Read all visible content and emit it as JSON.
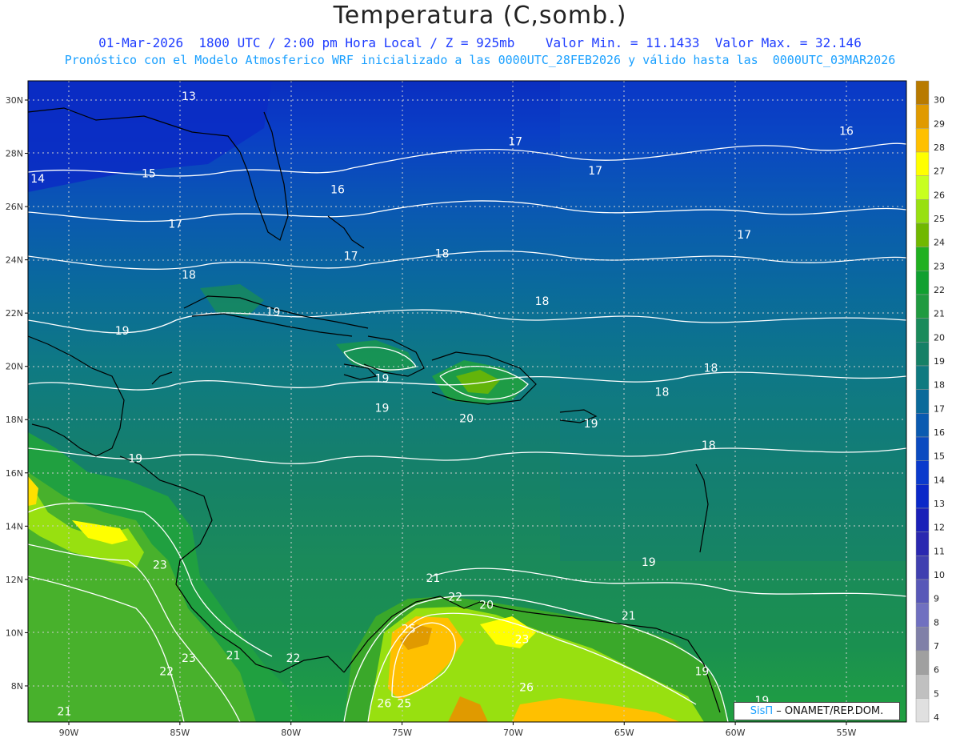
{
  "header": {
    "title": "Temperatura (C,somb.)",
    "line1": "01-Mar-2026  1800 UTC / 2:00 pm Hora Local / Z = 925mb    Valor Min. = 11.1433  Valor Max. = 32.146",
    "line2": "Pronóstico con el Modelo Atmosferico WRF inicializado a las 0000UTC_28FEB2026 y válido hasta las  0000UTC_03MAR2026"
  },
  "credit": {
    "brand": "SisΠ",
    "text": "– ONAMET/REP.DOM."
  },
  "axes": {
    "lon_labels": [
      "90W",
      "85W",
      "80W",
      "75W",
      "70W",
      "65W",
      "60W",
      "55W"
    ],
    "lat_labels": [
      "30N",
      "28N",
      "26N",
      "24N",
      "22N",
      "20N",
      "18N",
      "16N",
      "14N",
      "12N",
      "10N",
      "8N"
    ]
  },
  "colorbar": {
    "labels": [
      "30",
      "29",
      "28",
      "27",
      "26",
      "25",
      "24",
      "23",
      "22",
      "21",
      "20",
      "19",
      "18",
      "17",
      "16",
      "15",
      "14",
      "13",
      "12",
      "11",
      "10",
      "9",
      "8",
      "7",
      "6",
      "5",
      "4"
    ],
    "colors": [
      "#b87a00",
      "#e09a00",
      "#ffc000",
      "#ffff00",
      "#c8ff20",
      "#98e010",
      "#70b800",
      "#20b020",
      "#10a030",
      "#209a40",
      "#1a8a5a",
      "#158066",
      "#0f7a80",
      "#0a6a9a",
      "#0a5ab0",
      "#0a4ac0",
      "#0a3acc",
      "#0a28c8",
      "#1a20b8",
      "#2a28b0",
      "#4040b0",
      "#5858b8",
      "#7070c0",
      "#8080a8",
      "#a0a0a0",
      "#c0c0c0",
      "#e0e0e0"
    ]
  },
  "isotherm_labels": [
    {
      "t": "13",
      "lon": -84.6,
      "lat": 30.0
    },
    {
      "t": "14",
      "lon": -91.4,
      "lat": 26.9
    },
    {
      "t": "15",
      "lon": -86.4,
      "lat": 27.1
    },
    {
      "t": "16",
      "lon": -77.9,
      "lat": 26.5
    },
    {
      "t": "17",
      "lon": -69.9,
      "lat": 28.3
    },
    {
      "t": "17",
      "lon": -66.3,
      "lat": 27.2
    },
    {
      "t": "16",
      "lon": -55.0,
      "lat": 28.7
    },
    {
      "t": "17",
      "lon": -85.2,
      "lat": 25.2
    },
    {
      "t": "17",
      "lon": -59.6,
      "lat": 24.8
    },
    {
      "t": "17",
      "lon": -77.3,
      "lat": 24.0
    },
    {
      "t": "18",
      "lon": -73.2,
      "lat": 24.1
    },
    {
      "t": "18",
      "lon": -84.6,
      "lat": 23.3
    },
    {
      "t": "18",
      "lon": -68.7,
      "lat": 22.3
    },
    {
      "t": "19",
      "lon": -80.8,
      "lat": 21.9
    },
    {
      "t": "19",
      "lon": -87.6,
      "lat": 21.2
    },
    {
      "t": "18",
      "lon": -61.1,
      "lat": 19.8
    },
    {
      "t": "19",
      "lon": -75.9,
      "lat": 19.4
    },
    {
      "t": "18",
      "lon": -63.3,
      "lat": 18.9
    },
    {
      "t": "19",
      "lon": -75.9,
      "lat": 18.3
    },
    {
      "t": "20",
      "lon": -72.1,
      "lat": 17.9
    },
    {
      "t": "19",
      "lon": -66.5,
      "lat": 17.7
    },
    {
      "t": "18",
      "lon": -61.2,
      "lat": 16.9
    },
    {
      "t": "19",
      "lon": -87.0,
      "lat": 16.4
    },
    {
      "t": "23",
      "lon": -85.9,
      "lat": 12.4
    },
    {
      "t": "19",
      "lon": -63.9,
      "lat": 12.5
    },
    {
      "t": "21",
      "lon": -73.6,
      "lat": 11.9
    },
    {
      "t": "22",
      "lon": -72.6,
      "lat": 11.2
    },
    {
      "t": "20",
      "lon": -71.2,
      "lat": 10.9
    },
    {
      "t": "21",
      "lon": -64.8,
      "lat": 10.5
    },
    {
      "t": "25",
      "lon": -74.7,
      "lat": 10.0
    },
    {
      "t": "23",
      "lon": -69.6,
      "lat": 9.6
    },
    {
      "t": "19",
      "lon": -61.5,
      "lat": 8.4
    },
    {
      "t": "23",
      "lon": -84.6,
      "lat": 8.9
    },
    {
      "t": "21",
      "lon": -82.6,
      "lat": 9.0
    },
    {
      "t": "22",
      "lon": -79.9,
      "lat": 8.9
    },
    {
      "t": "22",
      "lon": -85.6,
      "lat": 8.4
    },
    {
      "t": "26",
      "lon": -69.4,
      "lat": 7.8
    },
    {
      "t": "26",
      "lon": -75.8,
      "lat": 7.2
    },
    {
      "t": "25",
      "lon": -74.9,
      "lat": 7.2
    },
    {
      "t": "19",
      "lon": -58.8,
      "lat": 7.3
    },
    {
      "t": "21",
      "lon": -90.2,
      "lat": 6.9
    }
  ]
}
